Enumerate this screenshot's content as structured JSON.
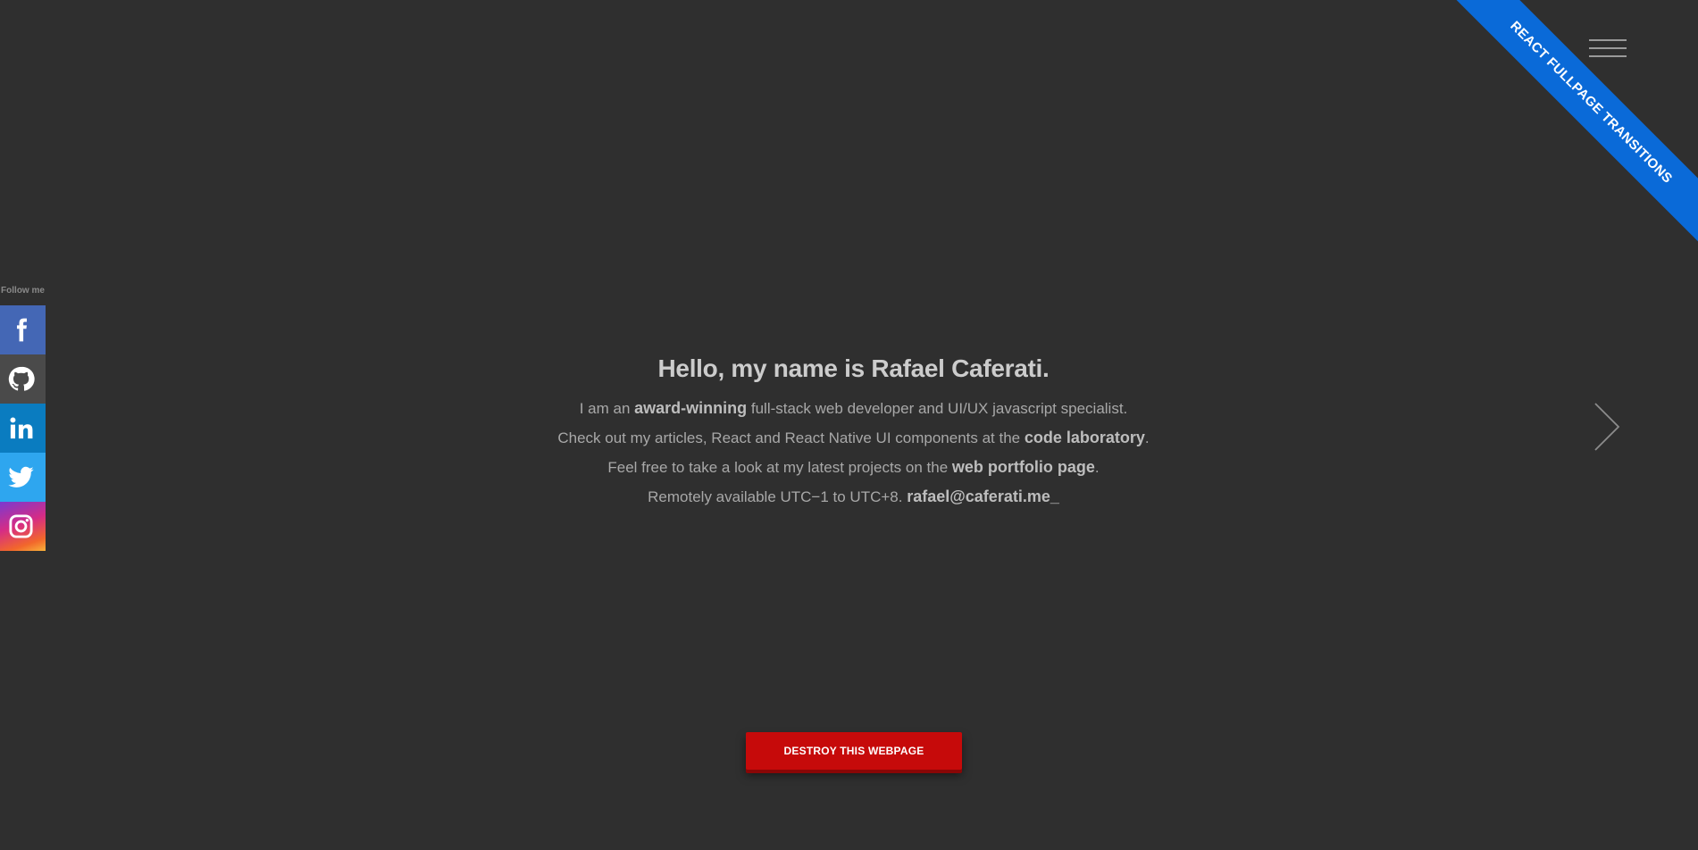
{
  "ribbon": {
    "label": "REACT FULLPAGE TRANSITIONS"
  },
  "nav": {
    "menu_icon": "hamburger-menu-icon"
  },
  "social": {
    "label": "Follow me",
    "items": [
      {
        "network": "Facebook",
        "icon": "facebook-icon",
        "color": "#4467b5"
      },
      {
        "network": "GitHub",
        "icon": "github-icon",
        "color": "#4a4a4a"
      },
      {
        "network": "LinkedIn",
        "icon": "linkedin-icon",
        "color": "#0a7cc0"
      },
      {
        "network": "Twitter",
        "icon": "twitter-icon",
        "color": "#2ea6ef"
      },
      {
        "network": "Instagram",
        "icon": "instagram-icon",
        "color": "#d52c86"
      }
    ]
  },
  "hero": {
    "title": "Hello, my name is Rafael Caferati.",
    "line1": {
      "pre": "I am an ",
      "bold": "award-winning",
      "post": " full-stack web developer and UI/UX javascript specialist."
    },
    "line2": {
      "pre": "Check out my articles, React and React Native UI components at the ",
      "link": "code laboratory",
      "post": "."
    },
    "line3": {
      "pre": "Feel free to take a look at my latest projects on the ",
      "link": "web portfolio page",
      "post": "."
    },
    "line4": {
      "pre": "Remotely available UTC−1 to UTC+8. ",
      "link": "rafael@caferati.me_"
    }
  },
  "navigation": {
    "next_icon": "chevron-right-icon"
  },
  "cta": {
    "destroy_label": "DESTROY THIS WEBPAGE",
    "color": "#c60a0a"
  }
}
